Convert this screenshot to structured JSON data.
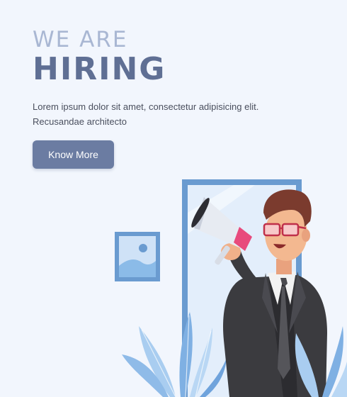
{
  "hero": {
    "eyebrow": "WE ARE",
    "headline": "HIRING",
    "description": "Lorem ipsum dolor sit amet, consectetur adipisicing elit. Recusandae architecto",
    "cta_label": "Know More"
  },
  "illustration": {
    "subject": "man-with-megaphone",
    "icons": [
      "picture-frame-icon",
      "megaphone-icon",
      "plant-leaves-icon"
    ]
  },
  "colors": {
    "background": "#f2f6fd",
    "eyebrow": "#a9b7d3",
    "headline": "#5f6f94",
    "button": "#6b7ca2",
    "door_frame": "#6a9bd0",
    "megaphone_accent": "#e84a7c"
  }
}
